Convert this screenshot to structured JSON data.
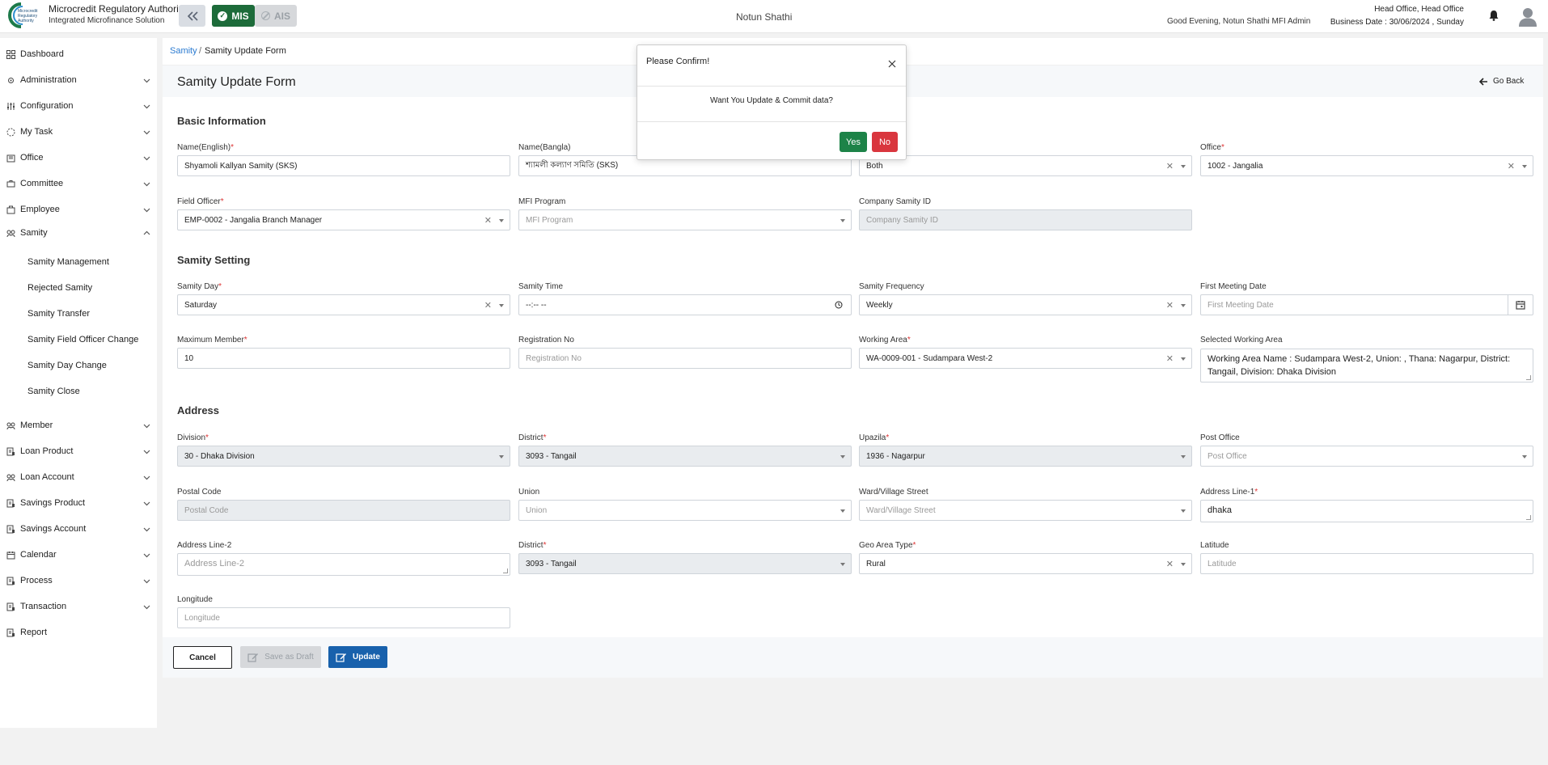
{
  "header": {
    "brand_title": "Microcredit Regulatory Authority",
    "brand_subtitle": "Integrated Microfinance Solution",
    "logo_text": "Microcredit Regulatory Authority",
    "mis_label": "MIS",
    "ais_label": "AIS",
    "org_name": "Notun Shathi",
    "greeting": "Good Evening, Notun Shathi MFI Admin",
    "office": "Head Office, Head Office",
    "business_date": "Business Date : 30/06/2024 , Sunday"
  },
  "sidebar": {
    "items": [
      {
        "label": "Dashboard",
        "icon": "dashboard-icon"
      },
      {
        "label": "Administration",
        "icon": "admin-icon"
      },
      {
        "label": "Configuration",
        "icon": "config-icon"
      },
      {
        "label": "My Task",
        "icon": "task-icon"
      },
      {
        "label": "Office",
        "icon": "office-icon"
      },
      {
        "label": "Committee",
        "icon": "committee-icon"
      },
      {
        "label": "Employee",
        "icon": "employee-icon"
      },
      {
        "label": "Samity",
        "icon": "samity-icon"
      },
      {
        "label": "Member",
        "icon": "member-icon"
      },
      {
        "label": "Loan Product",
        "icon": "loan-product-icon"
      },
      {
        "label": "Loan Account",
        "icon": "loan-account-icon"
      },
      {
        "label": "Savings Product",
        "icon": "savings-product-icon"
      },
      {
        "label": "Savings Account",
        "icon": "savings-account-icon"
      },
      {
        "label": "Calendar",
        "icon": "calendar-icon"
      },
      {
        "label": "Process",
        "icon": "process-icon"
      },
      {
        "label": "Transaction",
        "icon": "transaction-icon"
      },
      {
        "label": "Report",
        "icon": "report-icon"
      }
    ],
    "samity_sub": [
      "Samity Management",
      "Rejected Samity",
      "Samity Transfer",
      "Samity Field Officer Change",
      "Samity Day Change",
      "Samity Close"
    ]
  },
  "breadcrumb": {
    "parent": "Samity",
    "sep": "/",
    "current": "Samity Update Form"
  },
  "form": {
    "title": "Samity Update Form",
    "go_back": "Go Back",
    "sections": {
      "basic": "Basic Information",
      "setting": "Samity Setting",
      "address": "Address"
    },
    "labels": {
      "name_en": "Name(English)",
      "name_bn": "Name(Bangla)",
      "office": "Office",
      "field_officer": "Field Officer",
      "mfi_program": "MFI Program",
      "company_samity_id": "Company Samity ID",
      "samity_day": "Samity Day",
      "samity_time": "Samity Time",
      "samity_frequency": "Samity Frequency",
      "first_meeting_date": "First Meeting Date",
      "max_member": "Maximum Member",
      "registration_no": "Registration No",
      "working_area": "Working Area",
      "selected_working_area": "Selected Working Area",
      "division": "Division",
      "district": "District",
      "upazila": "Upazila",
      "post_office": "Post Office",
      "postal_code": "Postal Code",
      "union": "Union",
      "ward": "Ward/Village Street",
      "address1": "Address Line-1",
      "address2": "Address Line-2",
      "district2": "District",
      "geo_area_type": "Geo Area Type",
      "latitude": "Latitude",
      "longitude": "Longitude"
    },
    "values": {
      "name_en": "Shyamoli Kallyan Samity (SKS)",
      "name_bn": "শ্যামলী কল্যাণ সমিতি (SKS)",
      "gender": "Both",
      "office": "1002 - Jangalia",
      "field_officer": "EMP-0002 - Jangalia Branch Manager",
      "samity_day": "Saturday",
      "samity_time": "--:-- --",
      "samity_frequency": "Weekly",
      "max_member": "10",
      "working_area": "WA-0009-001 - Sudampara West-2",
      "selected_working_area": "Working Area Name : Sudampara West-2, Union: , Thana:  Nagarpur, District: Tangail, Division: Dhaka Division",
      "division": "30 - Dhaka Division",
      "district": "3093 - Tangail",
      "upazila": "1936 - Nagarpur",
      "address1": "dhaka",
      "district2": "3093 - Tangail",
      "geo_area_type": "Rural"
    },
    "placeholders": {
      "mfi_program": "MFI Program",
      "company_samity_id": "Company Samity ID",
      "first_meeting_date": "First Meeting Date",
      "registration_no": "Registration No",
      "post_office": "Post Office",
      "postal_code": "Postal Code",
      "union": "Union",
      "ward": "Ward/Village Street",
      "address2": "Address Line-2",
      "latitude": "Latitude",
      "longitude": "Longitude"
    },
    "buttons": {
      "cancel": "Cancel",
      "draft": "Save as Draft",
      "update": "Update"
    }
  },
  "modal": {
    "title": "Please Confirm!",
    "body": "Want You Update & Commit data?",
    "yes": "Yes",
    "no": "No"
  },
  "colors": {
    "accent": "#1861ac",
    "mis": "#1d6b3a",
    "yes": "#1d8348",
    "no": "#d9363e",
    "link": "#2b7bd1"
  }
}
